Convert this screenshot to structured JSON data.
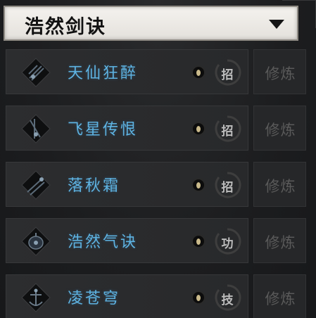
{
  "header": {
    "title": "浩然剑诀",
    "dropdown_icon": "triangle-down-icon"
  },
  "skills": [
    {
      "name": "天仙狂醉",
      "icon": "sword-emblem-icon",
      "badge": "招",
      "action_label": "修炼"
    },
    {
      "name": "飞星传恨",
      "icon": "sword-emblem-icon",
      "badge": "招",
      "action_label": "修炼"
    },
    {
      "name": "落秋霜",
      "icon": "sword-emblem-icon",
      "badge": "招",
      "action_label": "修炼"
    },
    {
      "name": "浩然气诀",
      "icon": "bell-emblem-icon",
      "badge": "功",
      "action_label": "修炼"
    },
    {
      "name": "凌苍穹",
      "icon": "anchor-emblem-icon",
      "badge": "技",
      "action_label": "修炼"
    }
  ],
  "colors": {
    "skill_name": "#5eb3e2",
    "action_disabled": "#5a5a5a",
    "header_bg": "#ebe8e3"
  }
}
